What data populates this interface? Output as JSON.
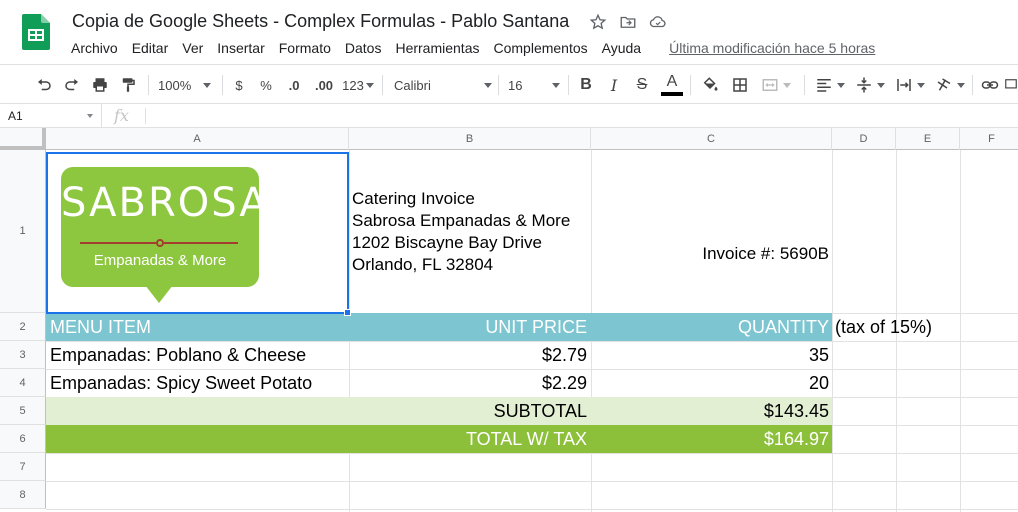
{
  "app": {
    "doc_title": "Copia de Google Sheets - Complex Formulas - Pablo Santana",
    "menu": [
      "Archivo",
      "Editar",
      "Ver",
      "Insertar",
      "Formato",
      "Datos",
      "Herramientas",
      "Complementos",
      "Ayuda"
    ],
    "last_edit": "Última modificación hace 5 horas",
    "icons": [
      "star-icon",
      "move-to-folder-icon",
      "cloud-status-icon"
    ]
  },
  "toolbar": {
    "zoom": "100%",
    "currency": "$",
    "percent": "%",
    "dec_decrease": ".0",
    "dec_increase": ".00",
    "more_formats": "123",
    "font": "Calibri",
    "font_size": "16",
    "bold": "B",
    "italic": "I",
    "strike": "S",
    "text_color": "A"
  },
  "formula_bar": {
    "cell_ref": "A1",
    "fx": "fx",
    "content": ""
  },
  "grid": {
    "columns": [
      "A",
      "B",
      "C",
      "D",
      "E",
      "F"
    ],
    "rows": [
      "1",
      "2",
      "3",
      "4",
      "5",
      "6",
      "7",
      "8"
    ]
  },
  "logo": {
    "word": "SABROSA",
    "sub": "Empanadas & More",
    "color": "#8dc63f",
    "accent": "#a33d2f"
  },
  "invoice": {
    "lines": [
      "Catering Invoice",
      "Sabrosa Empanadas & More",
      "1202 Biscayne Bay Drive",
      "Orlando, FL 32804"
    ],
    "number": "Invoice #:  5690B"
  },
  "table": {
    "header": {
      "item": "MENU ITEM",
      "price": "UNIT PRICE",
      "qty": "QUANTITY",
      "note": "(tax of 15%)"
    },
    "header_color": "#7dc5d0",
    "rows": [
      {
        "item": "Empanadas: Poblano & Cheese",
        "price": "$2.79",
        "qty": "35"
      },
      {
        "item": "Empanadas: Spicy Sweet Potato",
        "price": "$2.29",
        "qty": "20"
      }
    ],
    "subtotal": {
      "label": "SUBTOTAL",
      "value": "$143.45",
      "color": "#e2efd3"
    },
    "total": {
      "label": "TOTAL W/ TAX",
      "value": "$164.97",
      "color": "#8cbf3a"
    }
  }
}
